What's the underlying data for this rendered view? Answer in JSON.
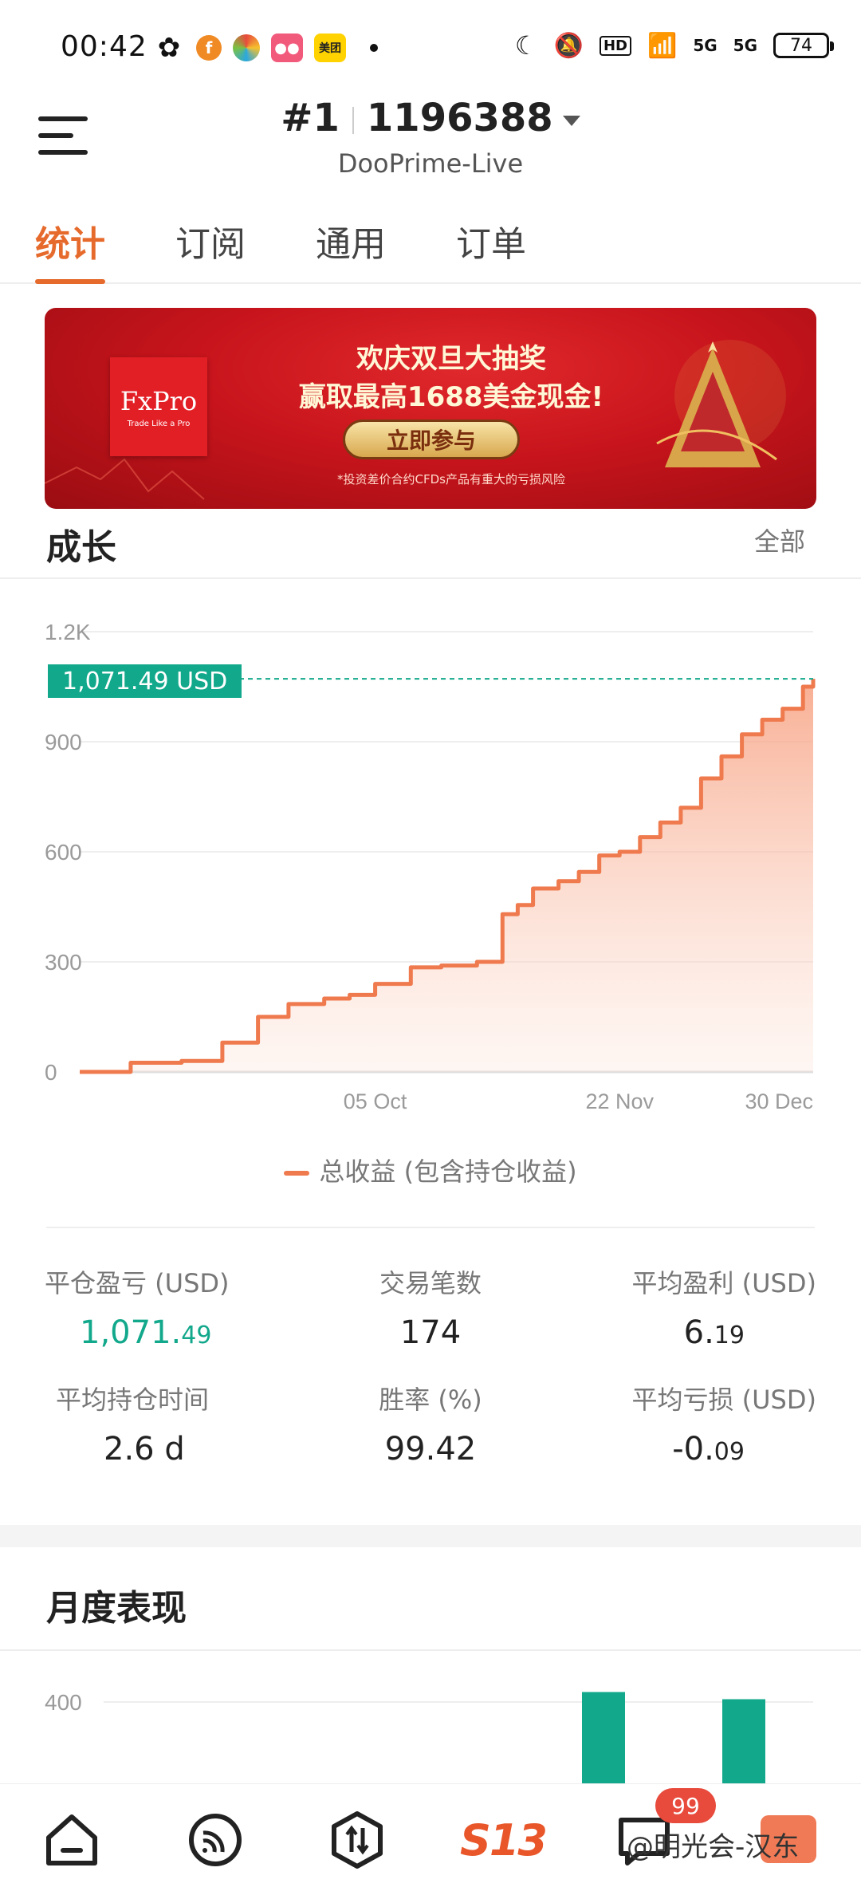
{
  "status_bar": {
    "time": "00:42",
    "apps": [
      "wechat-icon",
      "app-f-icon",
      "app-pinwheel-icon",
      "app-pink-icon",
      "meituan-icon"
    ],
    "meituan_label": "美团",
    "network": [
      "5G",
      "5G"
    ],
    "battery": "74"
  },
  "header": {
    "account_prefix": "#1",
    "account_number": "1196388",
    "broker": "DooPrime-Live"
  },
  "tabs": [
    {
      "label": "统计",
      "active": true
    },
    {
      "label": "订阅",
      "active": false
    },
    {
      "label": "通用",
      "active": false
    },
    {
      "label": "订单",
      "active": false
    }
  ],
  "banner": {
    "brand": "FxPro",
    "brand_tagline": "Trade Like a Pro",
    "headline_1": "欢庆双旦大抽奖",
    "headline_2": "赢取最高1688美金现金!",
    "cta": "立即参与",
    "note": "*投资差价合约CFDs产品有重大的亏损风险"
  },
  "growth": {
    "title": "成长",
    "filter": "全部"
  },
  "current_value_badge": "1,071.49 USD",
  "chart_data": {
    "type": "area",
    "title": "",
    "y_ticks": [
      "1.2K",
      "900",
      "600",
      "300",
      "0"
    ],
    "x_ticks": [
      "05 Oct",
      "22 Nov",
      "30 Dec"
    ],
    "ylim": [
      0,
      1200
    ],
    "series": [
      {
        "name": "总收益 (包含持仓收益)",
        "color": "#ef7a4e",
        "x": [
          "08 Aug",
          "18 Aug",
          "28 Aug",
          "05 Sep",
          "12 Sep",
          "18 Sep",
          "25 Sep",
          "30 Sep",
          "05 Oct",
          "12 Oct",
          "18 Oct",
          "25 Oct",
          "30 Oct",
          "02 Nov",
          "05 Nov",
          "10 Nov",
          "14 Nov",
          "18 Nov",
          "22 Nov",
          "26 Nov",
          "30 Nov",
          "04 Dec",
          "08 Dec",
          "12 Dec",
          "16 Dec",
          "20 Dec",
          "24 Dec",
          "28 Dec",
          "30 Dec"
        ],
        "y": [
          0,
          25,
          30,
          80,
          150,
          185,
          200,
          210,
          240,
          285,
          290,
          300,
          430,
          455,
          500,
          520,
          545,
          590,
          600,
          640,
          680,
          720,
          800,
          860,
          920,
          960,
          990,
          1050,
          1071.49
        ]
      }
    ],
    "reference_line": 1071.49,
    "legend": "总收益 (包含持仓收益)",
    "grid": true
  },
  "stats": [
    {
      "label": "平仓盈亏 (USD)",
      "value_main": "1,071.",
      "value_small": "49",
      "green": true
    },
    {
      "label": "交易笔数",
      "value_main": "174",
      "value_small": "",
      "green": false
    },
    {
      "label": "平均盈利 (USD)",
      "value_main": "6.",
      "value_small": "19",
      "green": false
    },
    {
      "label": "平均持仓时间",
      "value_main": "2.6 d",
      "value_small": "",
      "green": false
    },
    {
      "label": "胜率 (%)",
      "value_main": "99.42",
      "value_small": "",
      "green": false
    },
    {
      "label": "平均亏损 (USD)",
      "value_main": "-0.",
      "value_small": "09",
      "green": false
    }
  ],
  "monthly": {
    "title": "月度表现",
    "y_tick": "400",
    "bars_color": "#12a88b",
    "bars_visible": [
      {
        "value": 375
      },
      {
        "value": 345
      }
    ]
  },
  "bottom_nav": {
    "items": [
      "home-icon",
      "signal-icon",
      "trade-icon",
      "s13-logo",
      "message-icon",
      "profile-icon"
    ],
    "s13": "S13",
    "badge": "99",
    "watermark": "@明光会-汉东"
  }
}
